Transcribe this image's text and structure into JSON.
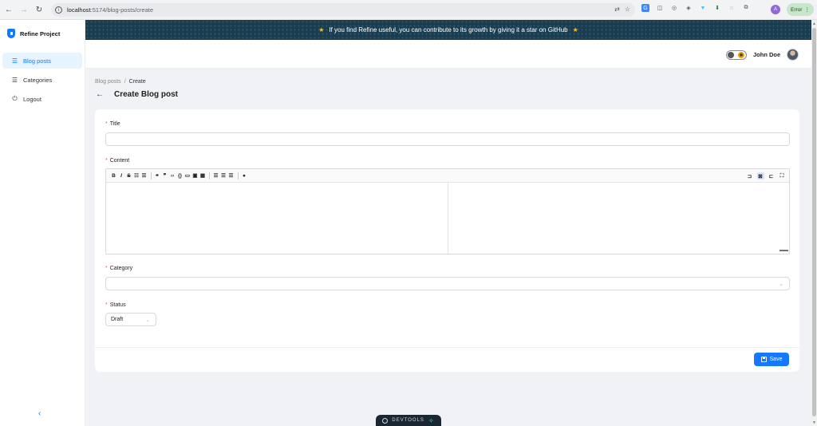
{
  "browser": {
    "url_host": "localhost",
    "url_path": ":5174/blog-posts/create",
    "profile_initial": "A",
    "error_label": "Error"
  },
  "sidebar": {
    "brand": "Refine Project",
    "items": [
      {
        "label": "Blog posts",
        "icon": "list-icon",
        "active": true
      },
      {
        "label": "Categories",
        "icon": "list-icon",
        "active": false
      },
      {
        "label": "Logout",
        "icon": "logout-icon",
        "active": false
      }
    ],
    "collapse_glyph": "‹"
  },
  "banner": {
    "text": "If you find Refine useful, you can contribute to its growth by giving it a star on GitHub"
  },
  "header": {
    "user_name": "John Doe"
  },
  "breadcrumb": {
    "parent": "Blog posts",
    "separator": "/",
    "current": "Create"
  },
  "page": {
    "title": "Create Blog post"
  },
  "form": {
    "title_label": "Title",
    "title_value": "",
    "content_label": "Content",
    "content_value": "",
    "category_label": "Category",
    "category_value": "",
    "status_label": "Status",
    "status_value": "Draft",
    "save_label": "Save"
  },
  "devtools": {
    "label": "DEVTOOLS"
  },
  "colors": {
    "primary": "#1677ff",
    "required": "#ff4d4f",
    "banner_bg": "#1b3d4f",
    "star": "#fbbf24"
  }
}
